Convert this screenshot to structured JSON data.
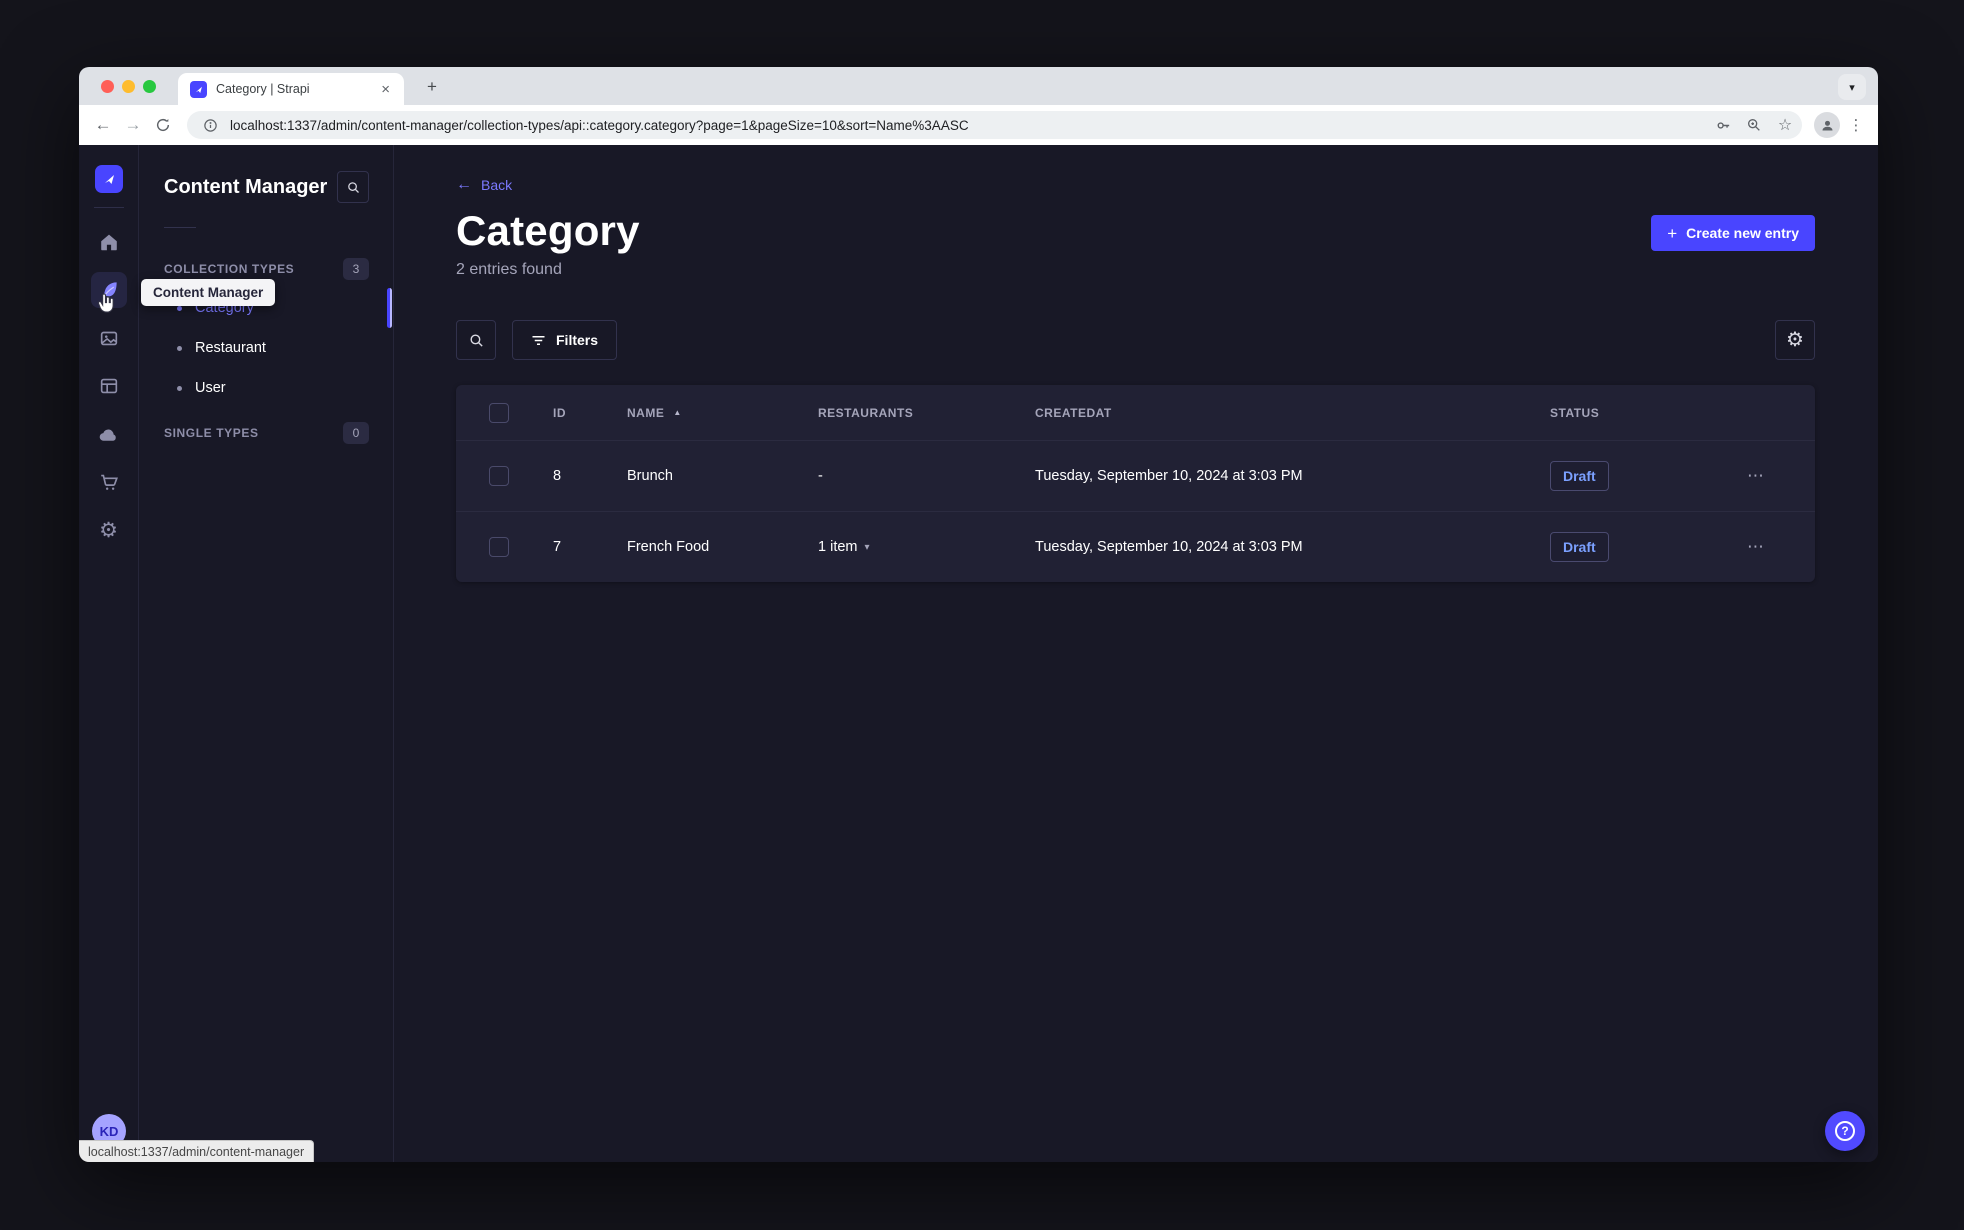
{
  "browser": {
    "tab_title": "Category | Strapi",
    "url": "localhost:1337/admin/content-manager/collection-types/api::category.category?page=1&pageSize=10&sort=Name%3AASC",
    "status_tooltip": "localhost:1337/admin/content-manager"
  },
  "icons": {
    "close": "×",
    "new_tab": "+",
    "tab_chevron": "▾",
    "back": "←",
    "forward": "→",
    "star": "☆",
    "kebab": "⋮",
    "gear": "⚙",
    "sort_asc": "▲",
    "item_chevron": "▾",
    "overflow_dots": "⋯",
    "back_arrow": "←",
    "plus": "+",
    "help": "?"
  },
  "sidebar": {
    "title": "Content Manager",
    "tooltip": "Content Manager",
    "collection_types_label": "COLLECTION TYPES",
    "collection_types_count": "3",
    "single_types_label": "SINGLE TYPES",
    "single_types_count": "0",
    "items": [
      {
        "label": "Category",
        "active": true
      },
      {
        "label": "Restaurant",
        "active": false
      },
      {
        "label": "User",
        "active": false
      }
    ]
  },
  "header": {
    "back_label": "Back",
    "title": "Category",
    "subtitle": "2 entries found",
    "create_button_label": "Create new entry"
  },
  "toolbar": {
    "filters_label": "Filters"
  },
  "table": {
    "columns": {
      "id": "ID",
      "name": "NAME",
      "restaurants": "RESTAURANTS",
      "createdAt": "CREATEDAT",
      "status": "STATUS"
    },
    "rows": [
      {
        "id": "8",
        "name": "Brunch",
        "restaurants": "-",
        "createdAt": "Tuesday, September 10, 2024 at 3:03 PM",
        "status": "Draft"
      },
      {
        "id": "7",
        "name": "French Food",
        "restaurants": "1 item",
        "createdAt": "Tuesday, September 10, 2024 at 3:03 PM",
        "status": "Draft"
      }
    ]
  },
  "user": {
    "initials": "KD"
  },
  "colors": {
    "primary": "#4945ff",
    "link": "#7b79ff",
    "app_bg": "#181826",
    "card_bg": "#212134",
    "border": "#32324d",
    "muted_text": "#a5a5ba",
    "draft_text": "#7ba0ff"
  }
}
